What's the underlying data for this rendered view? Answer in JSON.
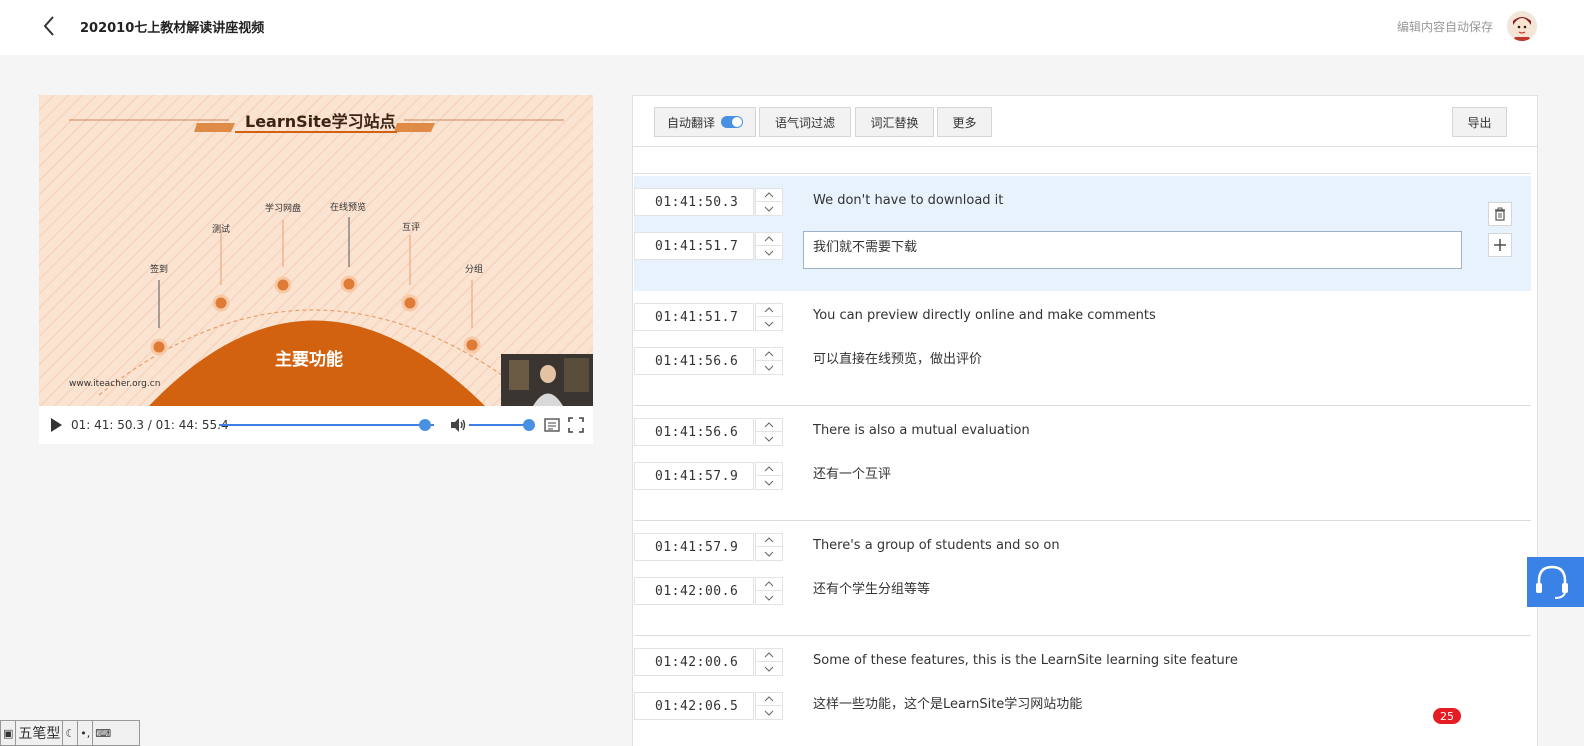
{
  "header": {
    "title": "202010七上教材解读讲座视频",
    "autosave_text": "编辑内容自动保存"
  },
  "video": {
    "slide_title": "LearnSite学习站点",
    "slide_center": "主要功能",
    "slide_url": "www.iteacher.org.cn",
    "slide_labels": [
      "签到",
      "测试",
      "学习网盘",
      "在线预览",
      "互评",
      "分组"
    ],
    "time_display": "01: 41: 50.3 / 01: 44: 55.4",
    "progress_fraction": 0.958,
    "volume_fraction": 1.0
  },
  "toolbar": {
    "auto_translate_label": "自动翻译",
    "auto_translate_on": true,
    "filter_label": "语气词过滤",
    "replace_label": "词汇替换",
    "more_label": "更多",
    "export_label": "导出"
  },
  "segments": [
    {
      "start": "01:41:50.3",
      "end": "01:41:51.7",
      "en": "We don't have to download it",
      "zh": "我们就不需要下载",
      "active": true
    },
    {
      "start": "01:41:51.7",
      "end": "01:41:56.6",
      "en": "You can preview directly online and make comments",
      "zh": "可以直接在线预览，做出评价",
      "active": false
    },
    {
      "start": "01:41:56.6",
      "end": "01:41:57.9",
      "en": "There is also a mutual evaluation",
      "zh": "还有一个互评",
      "active": false
    },
    {
      "start": "01:41:57.9",
      "end": "01:42:00.6",
      "en": "There's a group of students and so on",
      "zh": "还有个学生分组等等",
      "active": false
    },
    {
      "start": "01:42:00.6",
      "end": "01:42:06.5",
      "en": "Some of these features, this is the LearnSite learning site feature",
      "zh": "这样一些功能，这个是LearnSite学习网站功能",
      "active": false
    }
  ],
  "badge_count": "25",
  "ime": {
    "mode": "五笔型"
  },
  "colors": {
    "accent": "#4a90e2",
    "active_row": "#e8f2fc",
    "slide_orange": "#d2620f",
    "badge_red": "#e51c23"
  }
}
